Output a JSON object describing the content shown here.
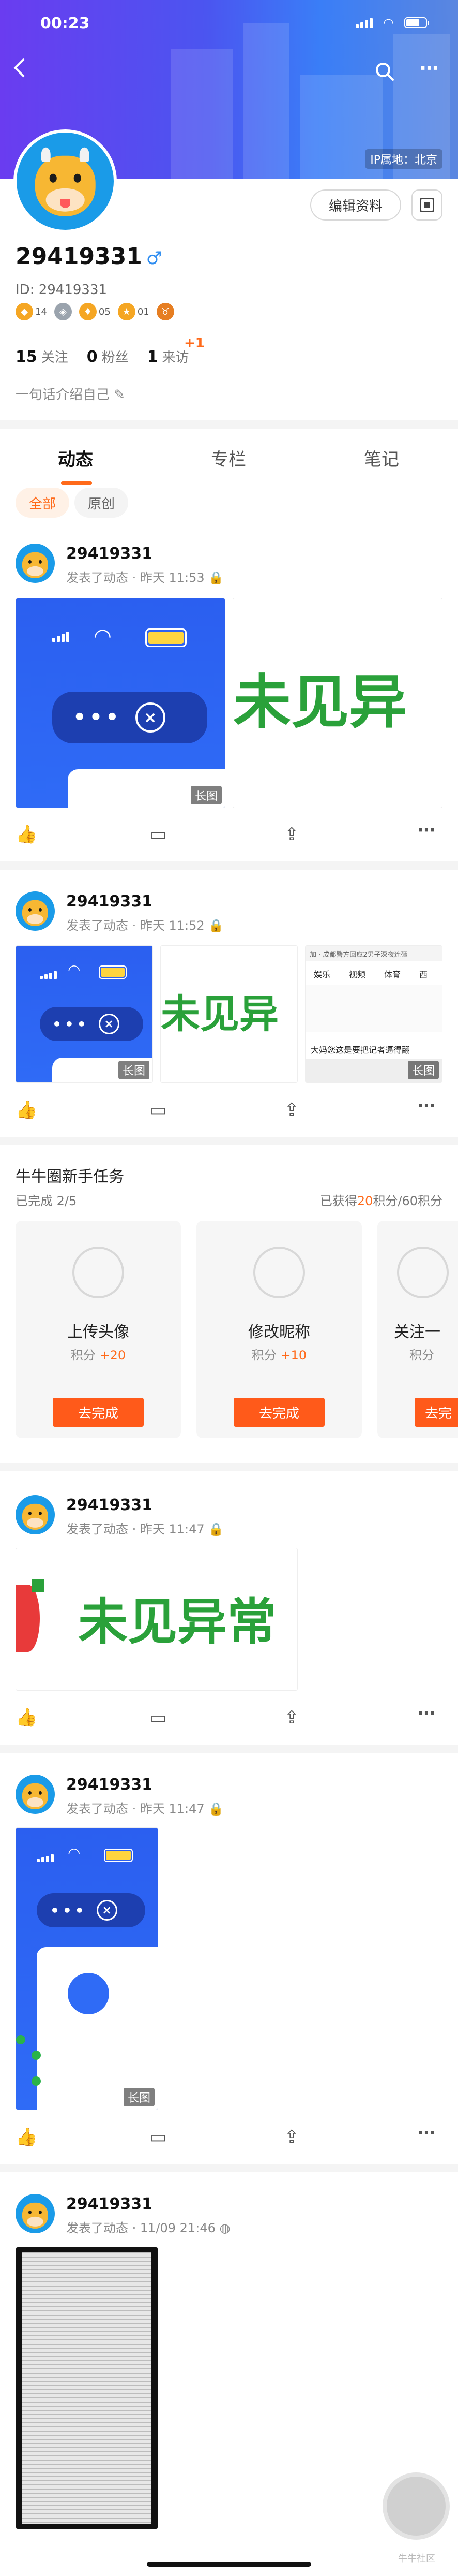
{
  "status_bar": {
    "time": "00:23"
  },
  "header": {
    "ip_label": "IP属地：北京",
    "edit_profile": "编辑资料"
  },
  "profile": {
    "username": "29419331",
    "gender_icon": "♂",
    "id_text": "ID: 29419331",
    "badges": [
      "14",
      "",
      "05",
      "01",
      ""
    ],
    "stats": [
      {
        "value": "15",
        "label": "关注"
      },
      {
        "value": "0",
        "label": "粉丝"
      },
      {
        "value": "1",
        "label": "来访"
      }
    ],
    "visit_delta": "+1",
    "bio_placeholder": "一句话介绍自己"
  },
  "tabs": [
    "动态",
    "专栏",
    "笔记"
  ],
  "filters": [
    "全部",
    "原创"
  ],
  "posts": [
    {
      "name": "29419331",
      "meta": "发表了动态 · 昨天 11:53",
      "tag": "长图",
      "img_text": "未见异"
    },
    {
      "name": "29419331",
      "meta": "发表了动态 · 昨天 11:52",
      "tag": "长图",
      "img_text": "未见异",
      "third_tabs": [
        "娱乐",
        "视频",
        "体育",
        "西"
      ],
      "third_top": "加 · 成都警方回应2男子深夜连砸",
      "third_caption": "大妈您这是要把记者逼得翻"
    },
    {
      "name": "29419331",
      "meta": "发表了动态 · 昨天 11:47",
      "img_text": "未见异常"
    },
    {
      "name": "29419331",
      "meta": "发表了动态 · 昨天 11:47",
      "tag": "长图"
    },
    {
      "name": "29419331",
      "meta": "发表了动态 · 11/09 21:46"
    }
  ],
  "tasks": {
    "title": "牛牛圈新手任务",
    "done": "已完成 2/5",
    "points_prefix": "已获得",
    "points_value": "20",
    "points_suffix": "积分/60积分",
    "items": [
      {
        "name": "上传头像",
        "score_label": "积分",
        "score": "+20",
        "button": "去完成"
      },
      {
        "name": "修改昵称",
        "score_label": "积分",
        "score": "+10",
        "button": "去完成"
      },
      {
        "name": "关注一",
        "score_label": "积分",
        "score": "",
        "button": "去完"
      }
    ]
  },
  "watermark": "牛牛社区",
  "colors": {
    "accent": "#ff6a1a",
    "banner_start": "#6a3cf0",
    "banner_end": "#3a7ef7",
    "avatar_bg": "#1a9be8",
    "green_text": "#2aa13a"
  }
}
